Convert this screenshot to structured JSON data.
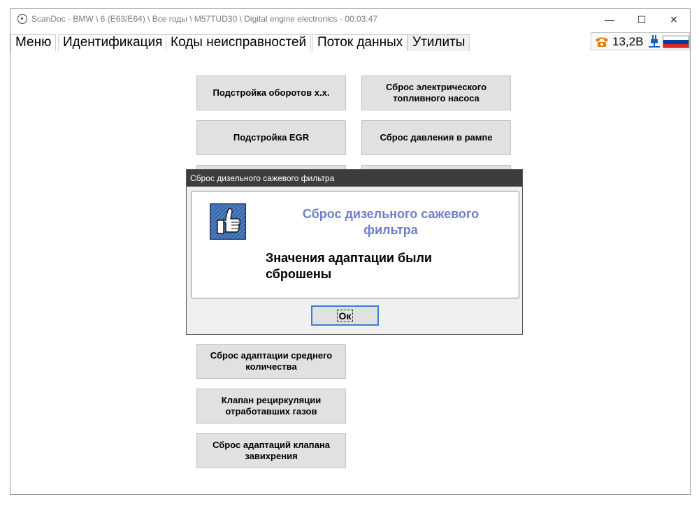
{
  "window": {
    "title": "ScanDoc - BMW \\ 6 (E63/E64) \\ Все годы \\ M57TUD30 \\ Digital engine electronics - 00:03:47",
    "minimize_glyph": "—",
    "maximize_glyph": "☐",
    "close_glyph": "✕"
  },
  "tabs": [
    {
      "label": "Меню"
    },
    {
      "label": "Идентификация"
    },
    {
      "label": "Коды неисправностей"
    },
    {
      "label": "Поток данных"
    },
    {
      "label": "Утилиты",
      "active": true
    }
  ],
  "status": {
    "voltage": "13,2В",
    "icons": [
      "phone-icon",
      "plug-icon",
      "russia-flag-icon"
    ]
  },
  "utilities": {
    "buttons": [
      {
        "label": "Подстройка оборотов х.х."
      },
      {
        "label": "Сброс электрического топливного насоса"
      },
      {
        "label": "Подстройка EGR"
      },
      {
        "label": "Сброс давления в рампе"
      },
      {
        "label": "Сброс адаптации среднего количества"
      },
      {
        "label": "Клапан рециркуляции отработавших газов"
      },
      {
        "label": "Сброс адаптаций клапана завихрения"
      }
    ]
  },
  "dialog": {
    "title": "Сброс дизельного сажевого фильтра",
    "heading": "Сброс дизельного сажевого фильтра",
    "message": "Значения адаптации были сброшены",
    "ok_label": "Ок",
    "icon": "thumbs-up-icon"
  },
  "colors": {
    "dialog_heading": "#6f7fc6",
    "dialog_titlebar": "#3d3d3d",
    "ok_focus_border": "#3a7fd5",
    "phone_icon": "#f07800",
    "plug_icon": "#1f5fb0",
    "flag": [
      "#ffffff",
      "#0039a6",
      "#d52b1e"
    ]
  }
}
